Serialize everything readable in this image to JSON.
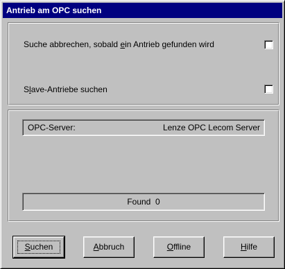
{
  "window": {
    "title": "Antrieb am OPC suchen"
  },
  "options": [
    {
      "label_pre": "Suche abbrechen, sobald ",
      "label_key": "e",
      "label_post": "in Antrieb gefunden wird",
      "checked": false
    },
    {
      "label_pre": "S",
      "label_key": "l",
      "label_post": "ave-Antriebe suchen",
      "checked": false
    }
  ],
  "server": {
    "label": "OPC-Server:",
    "value": "Lenze OPC Lecom Server"
  },
  "status": {
    "text": "Found  0"
  },
  "buttons": [
    {
      "key": "S",
      "rest": "uchen"
    },
    {
      "key": "A",
      "rest": "bbruch"
    },
    {
      "key": "O",
      "rest": "ffline"
    },
    {
      "key": "H",
      "rest": "ilfe"
    }
  ]
}
